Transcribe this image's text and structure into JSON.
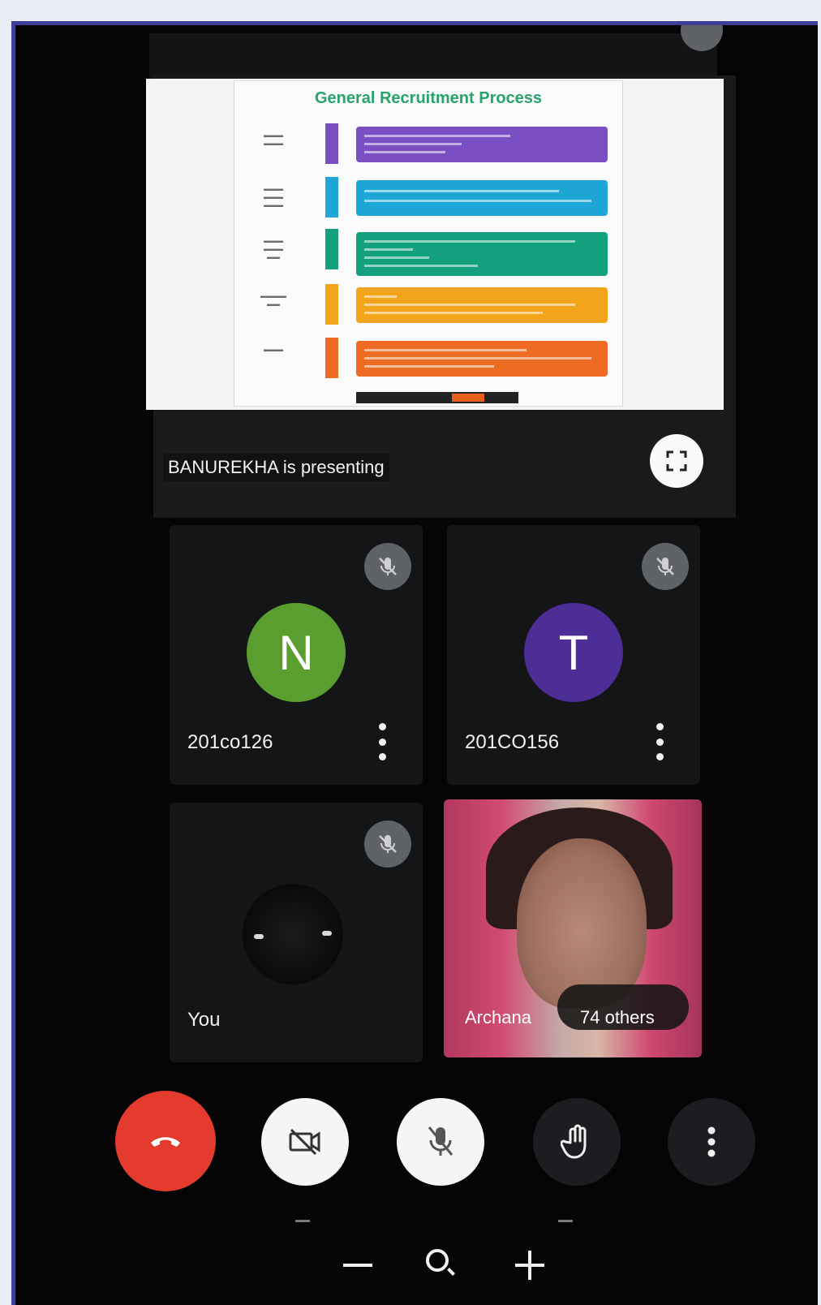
{
  "presentation": {
    "slide_title": "General Recruitment Process",
    "presenting_label": "BANUREKHA is presenting",
    "step_colors": [
      "#7a4fc4",
      "#1ea6d6",
      "#12a07f",
      "#f2a51a",
      "#ee6b23"
    ]
  },
  "participants": [
    {
      "name": "201co126",
      "initial": "N",
      "avatar_color": "#5a9e2f"
    },
    {
      "name": "201CO156",
      "initial": "T",
      "avatar_color": "#4d2d96"
    },
    {
      "name": "You"
    },
    {
      "name": "Archana",
      "others": "74 others"
    }
  ],
  "controls": {
    "end_call_color": "#e53b2f",
    "icons": [
      "end-call-icon",
      "camera-off-icon",
      "mic-off-icon",
      "raise-hand-icon",
      "more-vertical-icon"
    ]
  },
  "zoom": {
    "icons": [
      "zoom-out-icon",
      "zoom-reset-icon",
      "zoom-in-icon"
    ]
  }
}
